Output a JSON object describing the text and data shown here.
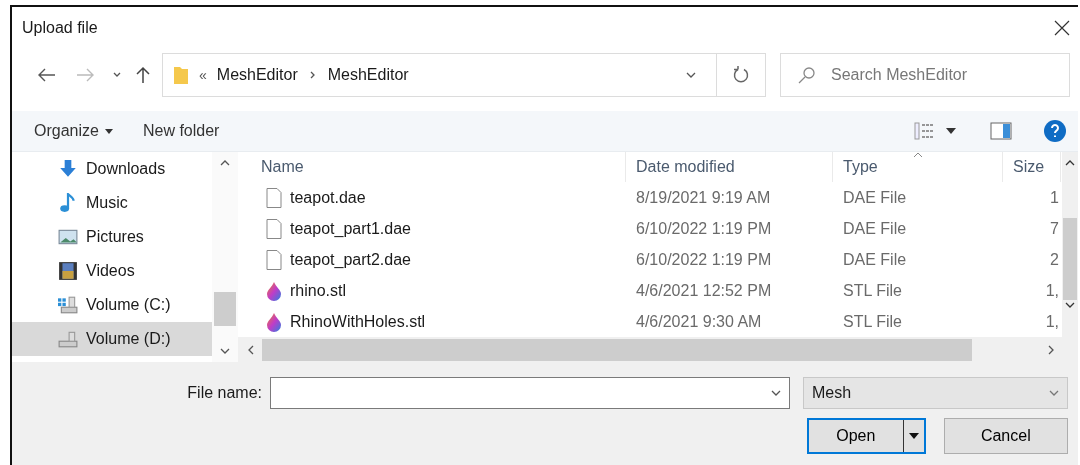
{
  "window": {
    "title": "Upload file"
  },
  "navigation": {
    "overflow": "«",
    "path": [
      "MeshEditor",
      "MeshEditor"
    ],
    "search_placeholder": "Search MeshEditor"
  },
  "toolbar": {
    "organize": "Organize",
    "new_folder": "New folder"
  },
  "sidebar": {
    "items": [
      {
        "label": "Downloads",
        "kind": "downloads",
        "selected": false
      },
      {
        "label": "Music",
        "kind": "music",
        "selected": false
      },
      {
        "label": "Pictures",
        "kind": "pictures",
        "selected": false
      },
      {
        "label": "Videos",
        "kind": "videos",
        "selected": false
      },
      {
        "label": "Volume (C:)",
        "kind": "system-drive",
        "selected": false
      },
      {
        "label": "Volume (D:)",
        "kind": "drive",
        "selected": true
      }
    ]
  },
  "table": {
    "columns": [
      {
        "label": "Name",
        "sorted": false
      },
      {
        "label": "Date modified",
        "sorted": false
      },
      {
        "label": "Type",
        "sorted": true
      },
      {
        "label": "Size",
        "sorted": false
      }
    ],
    "rows": [
      {
        "name": "teapot.dae",
        "date": "8/19/2021 9:19 AM",
        "type": "DAE File",
        "size": "1",
        "kind": "document"
      },
      {
        "name": "teapot_part1.dae",
        "date": "6/10/2022 1:19 PM",
        "type": "DAE File",
        "size": "7",
        "kind": "document"
      },
      {
        "name": "teapot_part2.dae",
        "date": "6/10/2022 1:19 PM",
        "type": "DAE File",
        "size": "2",
        "kind": "document"
      },
      {
        "name": "rhino.stl",
        "date": "4/6/2021 12:52 PM",
        "type": "STL File",
        "size": "1,",
        "kind": "mesh"
      },
      {
        "name": "RhinoWithHoles.stl",
        "date": "4/6/2021 9:30 AM",
        "type": "STL File",
        "size": "1,",
        "kind": "mesh"
      }
    ]
  },
  "footer": {
    "file_name_label": "File name:",
    "file_type": "Mesh",
    "buttons": [
      {
        "label": "Open",
        "default": true
      },
      {
        "label": "Cancel",
        "default": false
      }
    ]
  }
}
